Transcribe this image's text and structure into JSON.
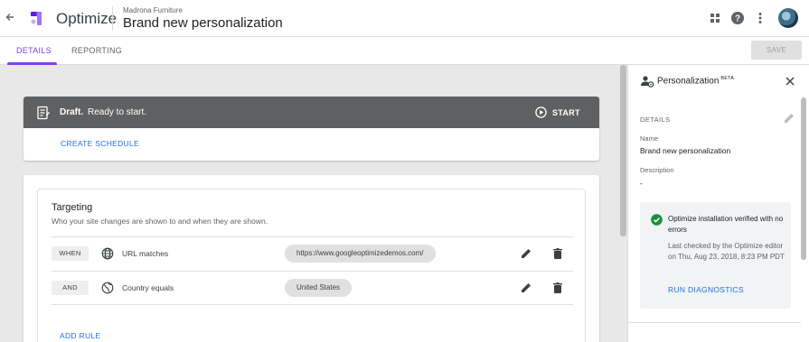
{
  "header": {
    "back_icon": "arrow-back-icon",
    "app_name": "Optimize",
    "account": "Madrona Furniture",
    "experience_name": "Brand new personalization",
    "icons": [
      "apps-grid-icon",
      "help-icon",
      "more-vert-icon",
      "avatar"
    ]
  },
  "tabs": [
    {
      "label": "DETAILS",
      "active": true
    },
    {
      "label": "REPORTING",
      "active": false
    }
  ],
  "toolbar": {
    "save_label": "SAVE"
  },
  "status": {
    "state": "Draft.",
    "message": "Ready to start.",
    "start_label": "START",
    "schedule_label": "CREATE SCHEDULE"
  },
  "targeting": {
    "title": "Targeting",
    "subtitle": "Who your site changes are shown to and when they are shown.",
    "rules": [
      {
        "operator": "WHEN",
        "icon": "globe-icon",
        "label": "URL matches",
        "value": "https://www.googleoptimizedemos.com/"
      },
      {
        "operator": "AND",
        "icon": "geo-icon",
        "label": "Country equals",
        "value": "United States"
      }
    ],
    "add_rule_label": "ADD RULE"
  },
  "panel": {
    "title": "Personalization",
    "badge": "BETA",
    "section_label": "DETAILS",
    "name_label": "Name",
    "name_value": "Brand new personalization",
    "description_label": "Description",
    "description_value": "-",
    "verify_title": "Optimize installation verified with no errors",
    "verify_detail": "Last checked by the Optimize editor on Thu, Aug 23, 2018, 8:23 PM PDT",
    "run_diagnostics_label": "RUN DIAGNOSTICS"
  },
  "colors": {
    "accent": "#7e3ff2",
    "link": "#1a73e8",
    "status_bar": "#5f6061",
    "success": "#1e8e3e"
  }
}
